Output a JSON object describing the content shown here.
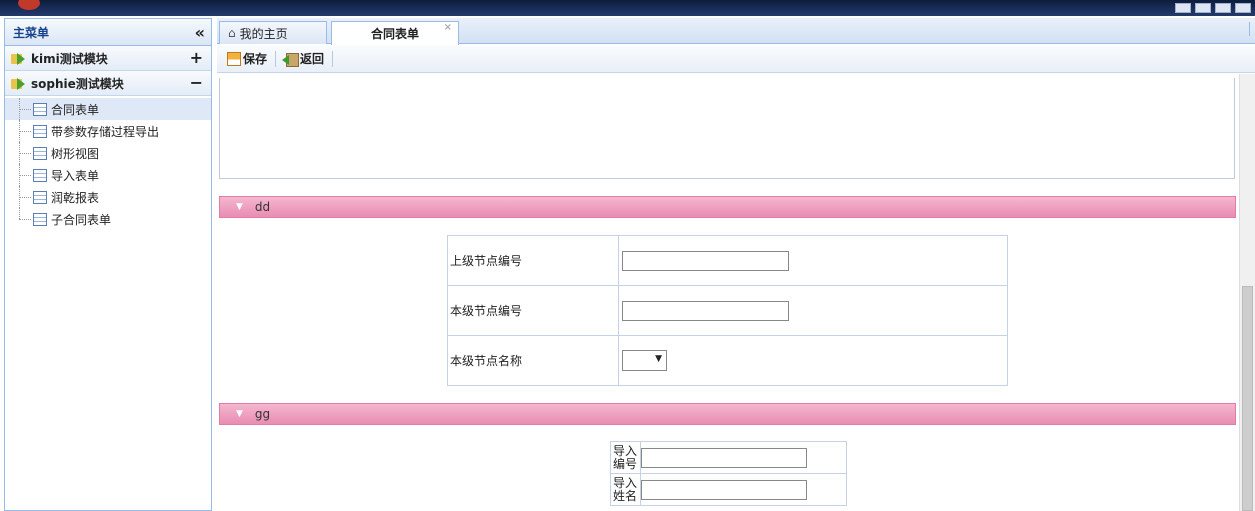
{
  "topbar": {
    "window_controls": [
      "min-icon",
      "restore-icon",
      "help-icon",
      "close-icon"
    ]
  },
  "sidebar": {
    "title": "主菜单",
    "collapse_glyph": "«",
    "modules": [
      {
        "label": "kimi测试模块",
        "toggle": "+",
        "expanded": false
      },
      {
        "label": "sophie测试模块",
        "toggle": "−",
        "expanded": true,
        "items": [
          {
            "label": "合同表单",
            "selected": true
          },
          {
            "label": "带参数存储过程导出"
          },
          {
            "label": "树形视图"
          },
          {
            "label": "导入表单"
          },
          {
            "label": "润乾报表"
          },
          {
            "label": "子合同表单"
          }
        ]
      }
    ]
  },
  "tabs": [
    {
      "label": "我的主页",
      "icon": "home-icon"
    },
    {
      "label": "合同表单",
      "active": true,
      "close": "×"
    }
  ],
  "toolbar": {
    "save_label": "保存",
    "back_label": "返回"
  },
  "sections": [
    {
      "title": "dd",
      "fields": [
        {
          "label": "上级节点编号",
          "type": "text",
          "value": ""
        },
        {
          "label": "本级节点编号",
          "type": "text",
          "value": ""
        },
        {
          "label": "本级节点名称",
          "type": "select",
          "value": ""
        }
      ]
    },
    {
      "title": "gg",
      "fields": [
        {
          "label": "导入编号",
          "type": "text",
          "value": ""
        },
        {
          "label": "导入姓名",
          "type": "text",
          "value": ""
        }
      ]
    }
  ],
  "colors": {
    "section_bar": "#e98db3",
    "border": "#99bbe8",
    "header_text": "#15428b"
  }
}
